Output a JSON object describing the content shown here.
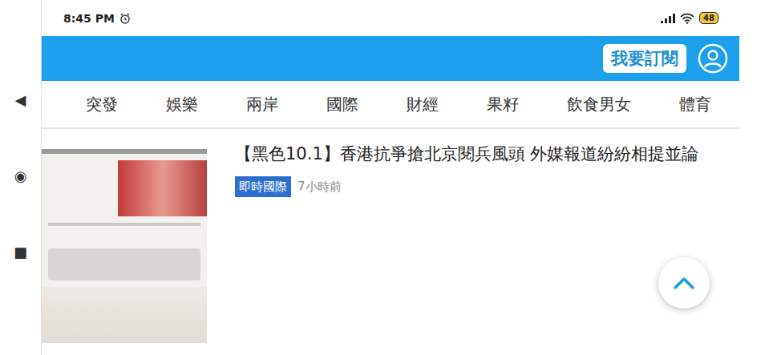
{
  "status_bar": {
    "time": "8:45 PM",
    "battery": "48"
  },
  "nav_buttons": [
    "◀",
    "◉",
    "■"
  ],
  "header": {
    "subscribe": "我要訂閱"
  },
  "categories": [
    {
      "label": "突發",
      "selected": false
    },
    {
      "label": "娛樂",
      "selected": false
    },
    {
      "label": "兩岸",
      "selected": false
    },
    {
      "label": "國際",
      "selected": false
    },
    {
      "label": "財經",
      "selected": false
    },
    {
      "label": "果籽",
      "selected": false
    },
    {
      "label": "飲食男女",
      "selected": false
    },
    {
      "label": "體育",
      "selected": false
    }
  ],
  "article": {
    "title": "【黑色10.1】香港抗爭搶北京閱兵風頭 外媒報道紛紛相提並論",
    "tag": "即時國際",
    "time": "7小時前"
  }
}
